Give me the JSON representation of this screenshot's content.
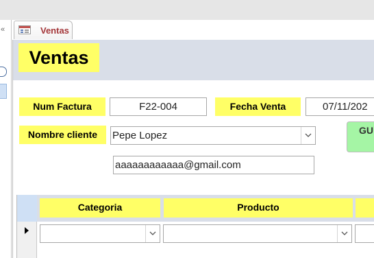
{
  "tab": {
    "label": "Ventas",
    "icon": "form-icon"
  },
  "navigation": {
    "collapse_icon": "chevron-left-icon",
    "search_icon": "search-icon"
  },
  "form": {
    "title": "Ventas",
    "num_factura": {
      "label": "Num Factura",
      "value": "F22-004"
    },
    "fecha_venta": {
      "label": "Fecha Venta",
      "value": "07/11/202"
    },
    "nombre_cliente": {
      "label": "Nombre cliente",
      "value": "Pepe Lopez"
    },
    "email": {
      "value": "aaaaaaaaaaaa@gmail.com"
    },
    "save_button": {
      "label": "GU"
    }
  },
  "subform": {
    "columns": [
      {
        "label": "Categoria"
      },
      {
        "label": "Producto"
      },
      {
        "label": ""
      }
    ],
    "rows": [
      {
        "categoria": "",
        "producto": "",
        "extra": ""
      }
    ]
  },
  "colors": {
    "label_bg": "#ffff66",
    "header_bg": "#d9dee8",
    "tab_text": "#a4373a",
    "button_bg": "#a5f5a5"
  }
}
